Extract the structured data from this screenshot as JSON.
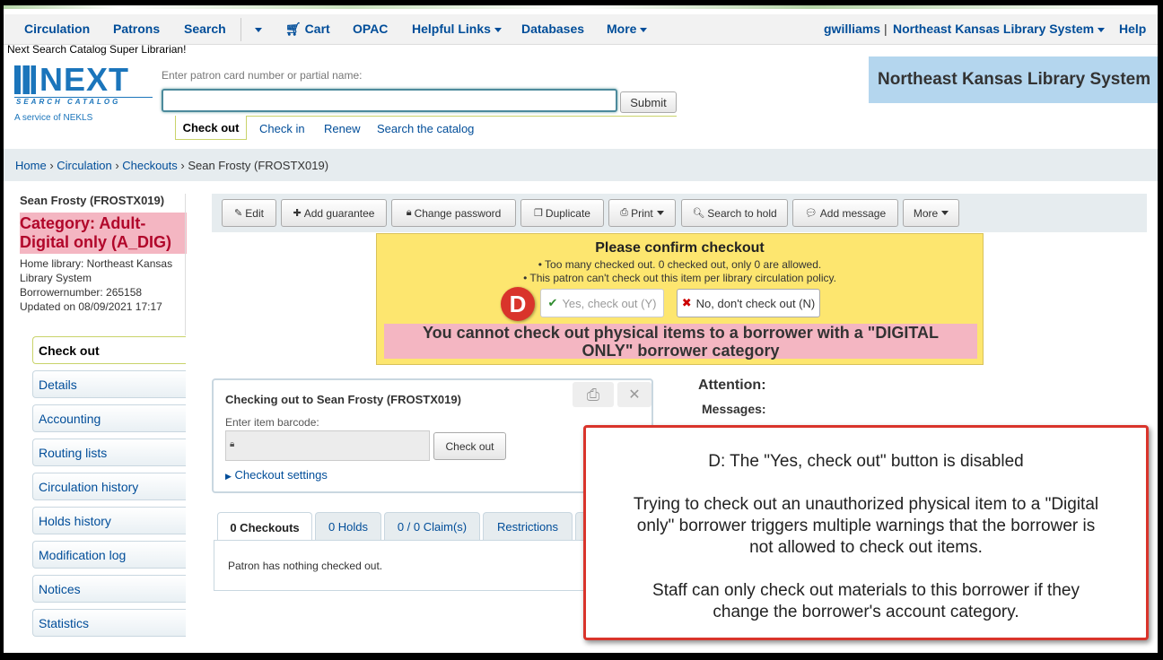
{
  "nav": {
    "circulation": "Circulation",
    "patrons": "Patrons",
    "search": "Search",
    "cart": "Cart",
    "opac": "OPAC",
    "helpful_links": "Helpful Links",
    "databases": "Databases",
    "more": "More",
    "user": "gwilliams",
    "separator": "|",
    "library": "Northeast Kansas Library System",
    "help": "Help"
  },
  "greeting": "Next Search Catalog Super Librarian!",
  "logo": {
    "text": "NEXT",
    "subtitle": "SEARCH CATALOG",
    "service": "A service of NEKLS"
  },
  "patron_search": {
    "label": "Enter patron card number or partial name:",
    "value": "",
    "submit": "Submit",
    "tabs": [
      "Check out",
      "Check in",
      "Renew",
      "Search the catalog"
    ]
  },
  "library_banner": "Northeast Kansas Library System",
  "breadcrumb": {
    "home": "Home",
    "circulation": "Circulation",
    "checkouts": "Checkouts",
    "current": "Sean Frosty (FROSTX019)",
    "sep": "›"
  },
  "patron": {
    "name": "Sean Frosty (FROSTX019)",
    "category": "Category: Adult-Digital only (A_DIG)",
    "home_library": "Home library: Northeast Kansas Library System",
    "borrowernumber": "Borrowernumber: 265158",
    "updated": "Updated on 08/09/2021 17:17"
  },
  "menu": [
    "Check out",
    "Details",
    "Accounting",
    "Routing lists",
    "Circulation history",
    "Holds history",
    "Modification log",
    "Notices",
    "Statistics"
  ],
  "toolbar": {
    "edit": "Edit",
    "add_guarantee": "Add guarantee",
    "change_password": "Change password",
    "duplicate": "Duplicate",
    "print": "Print",
    "search_to_hold": "Search to hold",
    "add_message": "Add message",
    "more": "More"
  },
  "confirm": {
    "title": "Please confirm checkout",
    "bullet1": "• Too many checked out. 0 checked out, only 0 are allowed.",
    "bullet2": "• This patron can't check out this item per library circulation policy.",
    "yes": "Yes, check out (Y)",
    "no": "No, don't check out (N)",
    "marker": "D",
    "digital_note_1": "You cannot check out physical items to a borrower with a \"DIGITAL",
    "digital_note_2": "ONLY\" borrower category"
  },
  "checkout": {
    "title": "Checking out to Sean Frosty (FROSTX019)",
    "barcode_label": "Enter item barcode:",
    "barcode_value": "",
    "button": "Check out",
    "settings": "Checkout settings"
  },
  "attention": {
    "title": "Attention:",
    "messages": "Messages:"
  },
  "tabs": {
    "checkouts": "0 Checkouts",
    "holds": "0 Holds",
    "claims": "0 / 0 Claim(s)",
    "restrictions": "Restrictions",
    "empty": "Patron has nothing checked out."
  },
  "annotation": {
    "line1": "D: The \"Yes, check out\" button is disabled",
    "line2": "Trying to check out an unauthorized physical item to a \"Digital",
    "line3": "only\" borrower triggers multiple warnings that the borrower is",
    "line4": "not allowed to check out items.",
    "line5": "Staff can only check out materials to this borrower if they",
    "line6": "change the borrower's account category."
  },
  "colors": {
    "link": "#004d99",
    "warning_bg": "#fde66f",
    "alert_pink": "#f4b6c2",
    "annotation_border": "#d9342b",
    "banner": "#b4d6ee"
  }
}
